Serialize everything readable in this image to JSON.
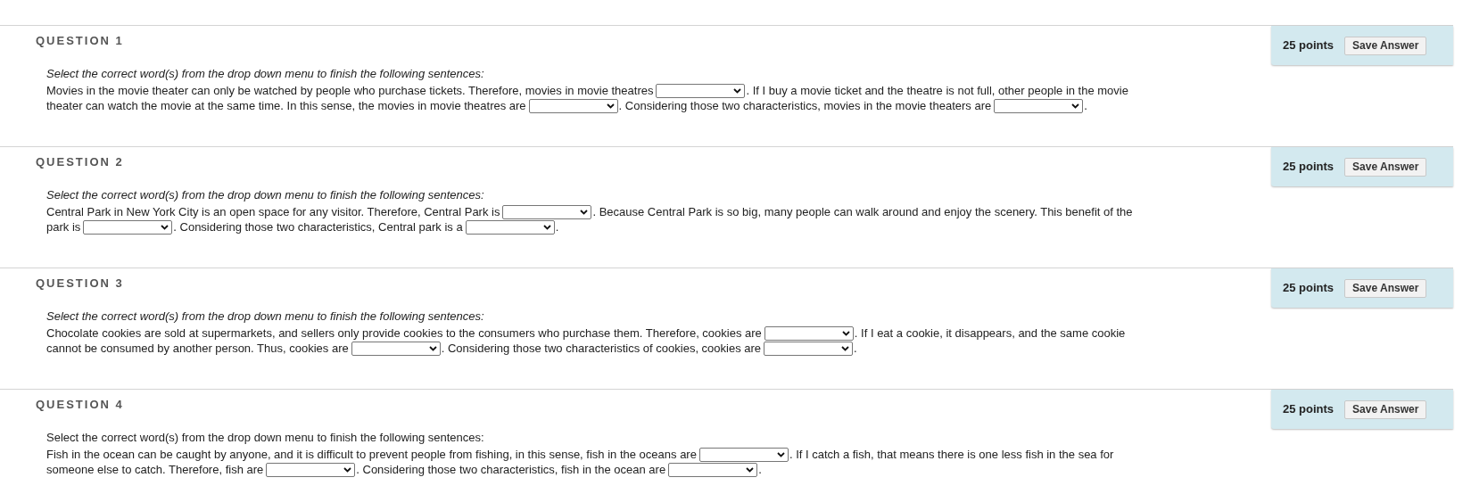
{
  "questions": [
    {
      "title": "QUESTION 1",
      "points": "25 points",
      "save_button": "Save Answer",
      "instruction": {
        "text": "Select the correct word(s) from the drop down menu to finish the following sentences:",
        "italic": true
      },
      "lines": [
        [
          {
            "kind": "text",
            "text": "Movies in the movie theater can only be watched by people who purchase tickets. Therefore, movies in movie theatres"
          },
          {
            "kind": "dropdown"
          },
          {
            "kind": "text",
            "text": ". If I buy a movie ticket and the theatre is not full, other people in the movie"
          }
        ],
        [
          {
            "kind": "text",
            "text": "theater can watch the movie at the same time. In this sense, the movies in movie theatres are"
          },
          {
            "kind": "dropdown"
          },
          {
            "kind": "text",
            "text": ". Considering those two characteristics, movies in the movie theaters are"
          },
          {
            "kind": "dropdown"
          },
          {
            "kind": "text",
            "text": "."
          }
        ]
      ]
    },
    {
      "title": "QUESTION 2",
      "points": "25 points",
      "save_button": "Save Answer",
      "instruction": {
        "text": "Select the correct word(s) from the drop down menu to finish the following sentences:",
        "italic": true
      },
      "lines": [
        [
          {
            "kind": "text",
            "text": "Central Park in New York City is an open space for any visitor. Therefore, Central Park is"
          },
          {
            "kind": "dropdown"
          },
          {
            "kind": "text",
            "text": ". Because Central Park is so big, many people can walk around and enjoy the scenery. This benefit of the"
          }
        ],
        [
          {
            "kind": "text",
            "text": "park is"
          },
          {
            "kind": "dropdown"
          },
          {
            "kind": "text",
            "text": ". Considering those two characteristics, Central park is a"
          },
          {
            "kind": "dropdown"
          },
          {
            "kind": "text",
            "text": "."
          }
        ]
      ]
    },
    {
      "title": "QUESTION 3",
      "points": "25 points",
      "save_button": "Save Answer",
      "instruction": {
        "text": "Select the correct word(s) from the drop down menu to finish the following sentences:",
        "italic": true
      },
      "lines": [
        [
          {
            "kind": "text",
            "text": "Chocolate cookies are sold at supermarkets, and sellers only provide cookies to the consumers who purchase them. Therefore, cookies are"
          },
          {
            "kind": "dropdown"
          },
          {
            "kind": "text",
            "text": ". If I eat a cookie, it disappears, and the same cookie"
          }
        ],
        [
          {
            "kind": "text",
            "text": "cannot be consumed by another person. Thus, cookies are"
          },
          {
            "kind": "dropdown"
          },
          {
            "kind": "text",
            "text": ". Considering those two characteristics of cookies, cookies are"
          },
          {
            "kind": "dropdown"
          },
          {
            "kind": "text",
            "text": "."
          }
        ]
      ]
    },
    {
      "title": "QUESTION 4",
      "points": "25 points",
      "save_button": "Save Answer",
      "instruction": {
        "text": "Select the correct word(s) from the drop down menu to finish the following sentences:",
        "italic": false
      },
      "lines": [
        [
          {
            "kind": "text",
            "text": "Fish in the ocean can be caught by anyone, and it is difficult to prevent people from fishing, in this sense, fish in the oceans are"
          },
          {
            "kind": "dropdown"
          },
          {
            "kind": "text",
            "text": ". If I catch a fish, that means there is one less fish in the sea for"
          }
        ],
        [
          {
            "kind": "text",
            "text": "someone else to catch. Therefore, fish are"
          },
          {
            "kind": "dropdown"
          },
          {
            "kind": "text",
            "text": ". Considering those two characteristics, fish in the ocean are"
          },
          {
            "kind": "dropdown"
          },
          {
            "kind": "text",
            "text": "."
          }
        ]
      ]
    }
  ]
}
